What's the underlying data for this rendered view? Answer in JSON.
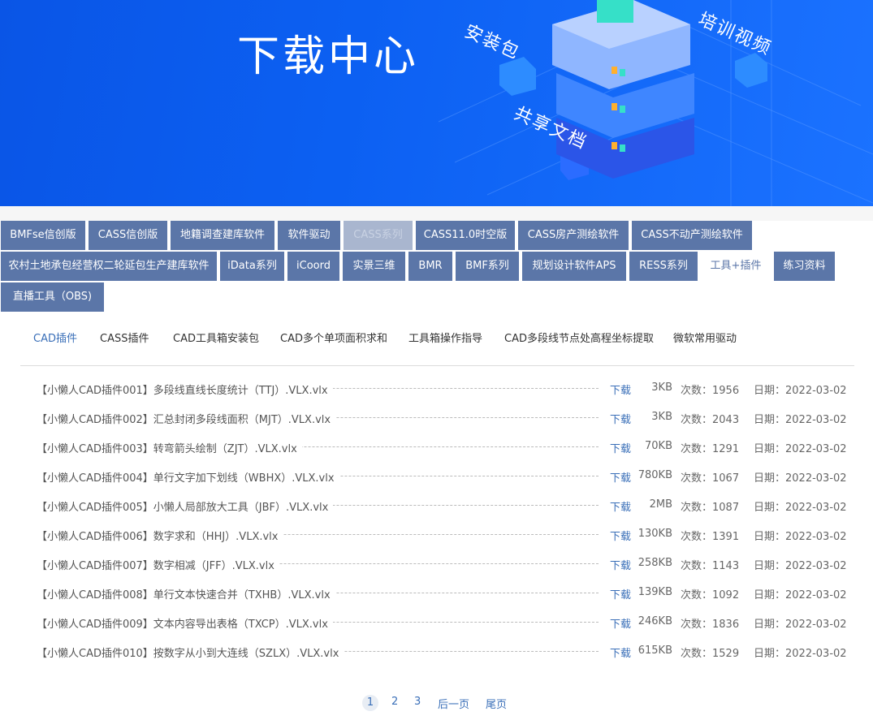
{
  "banner": {
    "title": "下载中心",
    "labels": {
      "install": "安装包",
      "training": "培训视频",
      "share": "共享文档"
    }
  },
  "tabs": [
    {
      "label": "BMFse信创版"
    },
    {
      "label": "CASS信创版"
    },
    {
      "label": "地籍调查建库软件"
    },
    {
      "label": "软件驱动"
    },
    {
      "label": "CASS系列"
    },
    {
      "label": "CASS11.0时空版"
    },
    {
      "label": "CASS房产测绘软件"
    },
    {
      "label": "CASS不动产测绘软件"
    },
    {
      "label": "农村土地承包经营权二轮延包生产建库软件"
    },
    {
      "label": "iData系列"
    },
    {
      "label": "iCoord"
    },
    {
      "label": "实景三维"
    },
    {
      "label": "BMR"
    },
    {
      "label": "BMF系列"
    },
    {
      "label": "规划设计软件APS"
    },
    {
      "label": "RESS系列"
    },
    {
      "label": "工具+插件"
    },
    {
      "label": "练习资料"
    },
    {
      "label": "直播工具（OBS)"
    }
  ],
  "subtabs": [
    {
      "label": "CAD插件"
    },
    {
      "label": "CASS插件"
    },
    {
      "label": "CAD工具箱安装包"
    },
    {
      "label": "CAD多个单项面积求和"
    },
    {
      "label": "工具箱操作指导"
    },
    {
      "label": "CAD多段线节点处高程坐标提取"
    },
    {
      "label": "微软常用驱动"
    }
  ],
  "files": [
    {
      "name": "【小懒人CAD插件001】多段线直线长度统计（TTJ）.VLX.vlx",
      "download": "下载",
      "size": "3KB",
      "count": "次数：1956",
      "date": "日期：2022-03-02"
    },
    {
      "name": "【小懒人CAD插件002】汇总封闭多段线面积（MJT）.VLX.vlx",
      "download": "下载",
      "size": "3KB",
      "count": "次数：2043",
      "date": "日期：2022-03-02"
    },
    {
      "name": "【小懒人CAD插件003】转弯箭头绘制（ZJT）.VLX.vlx",
      "download": "下载",
      "size": "70KB",
      "count": "次数：1291",
      "date": "日期：2022-03-02"
    },
    {
      "name": "【小懒人CAD插件004】单行文字加下划线（WBHX）.VLX.vlx",
      "download": "下载",
      "size": "780KB",
      "count": "次数：1067",
      "date": "日期：2022-03-02"
    },
    {
      "name": "【小懒人CAD插件005】小懒人局部放大工具（JBF）.VLX.vlx",
      "download": "下载",
      "size": "2MB",
      "count": "次数：1087",
      "date": "日期：2022-03-02"
    },
    {
      "name": "【小懒人CAD插件006】数字求和（HHJ）.VLX.vlx",
      "download": "下载",
      "size": "130KB",
      "count": "次数：1391",
      "date": "日期：2022-03-02"
    },
    {
      "name": "【小懒人CAD插件007】数字相减（JFF）.VLX.vlx",
      "download": "下载",
      "size": "258KB",
      "count": "次数：1143",
      "date": "日期：2022-03-02"
    },
    {
      "name": "【小懒人CAD插件008】单行文本快速合并（TXHB）.VLX.vlx",
      "download": "下载",
      "size": "139KB",
      "count": "次数：1092",
      "date": "日期：2022-03-02"
    },
    {
      "name": "【小懒人CAD插件009】文本内容导出表格（TXCP）.VLX.vlx",
      "download": "下载",
      "size": "246KB",
      "count": "次数：1836",
      "date": "日期：2022-03-02"
    },
    {
      "name": "【小懒人CAD插件010】按数字从小到大连线（SZLX）.VLX.vlx",
      "download": "下载",
      "size": "615KB",
      "count": "次数：1529",
      "date": "日期：2022-03-02"
    }
  ],
  "pagination": {
    "pages": [
      "1",
      "2",
      "3"
    ],
    "next": "后一页",
    "last": "尾页"
  },
  "colors": {
    "tab_bg": "#5b76a8",
    "accent": "#3a6fb8",
    "banner": "#0c60f2"
  }
}
